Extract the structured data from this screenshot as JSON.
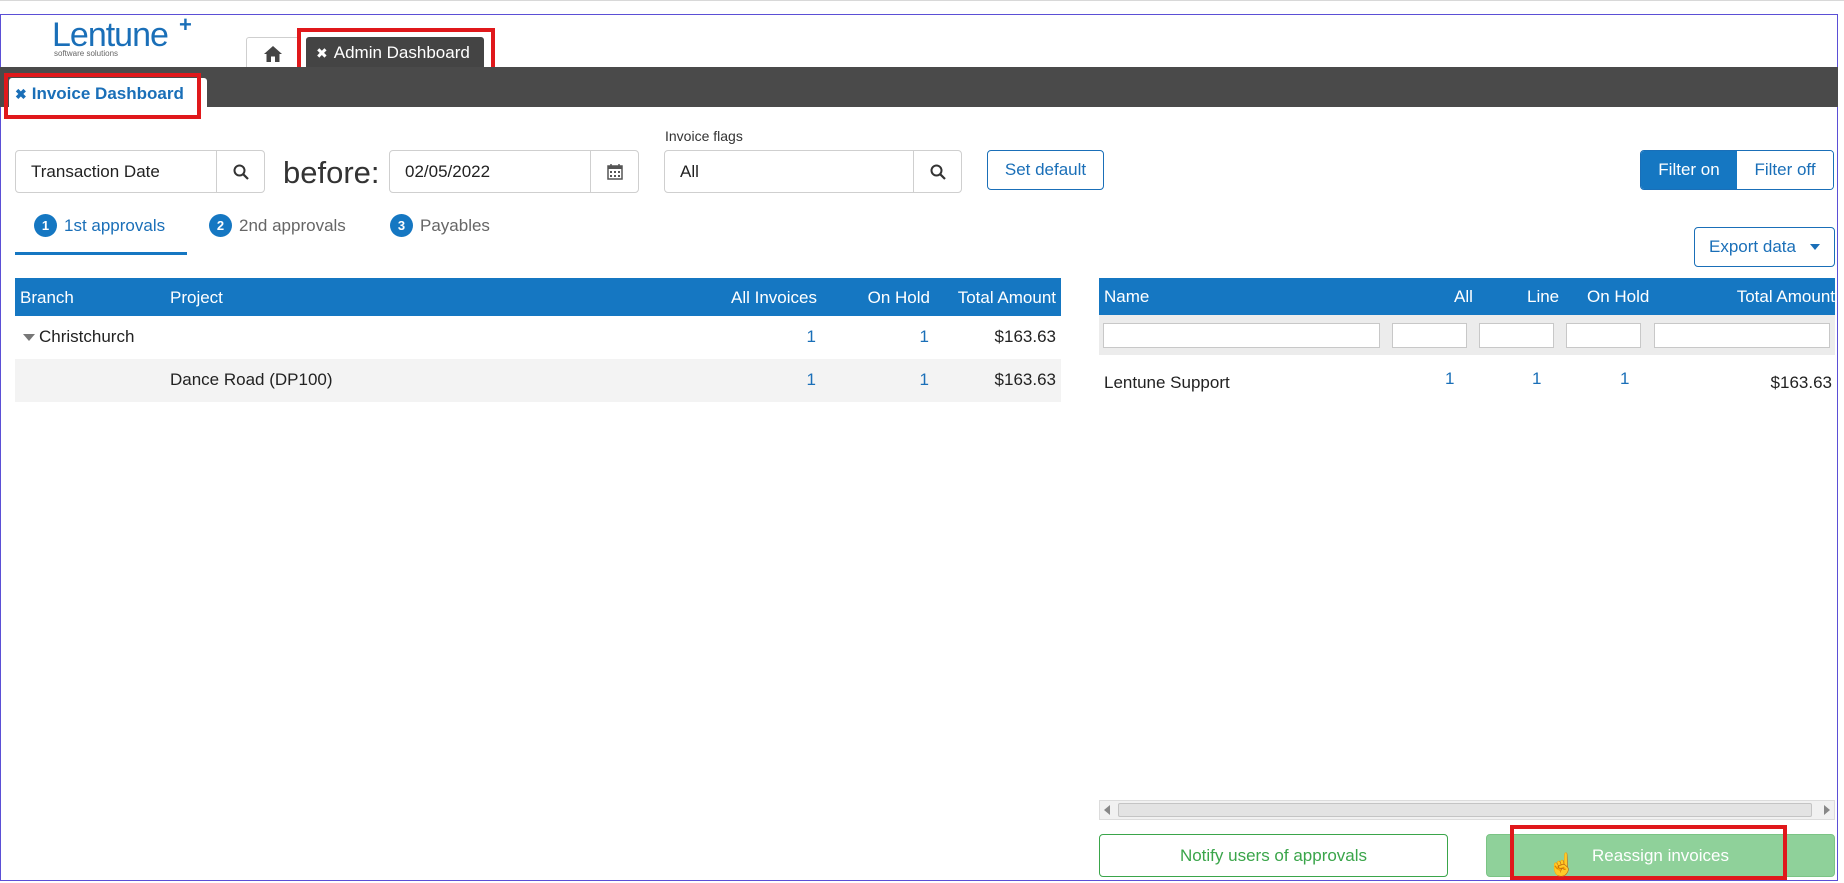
{
  "logo": {
    "word": "Lentune",
    "plus": "+",
    "sub": "software solutions"
  },
  "top_tabs": {
    "home_icon": "home-icon",
    "admin_tab": "Admin Dashboard",
    "close_glyph": "✖"
  },
  "page_tab": {
    "label": "Invoice Dashboard",
    "close_glyph": "✖"
  },
  "filters": {
    "date_field": "Transaction Date",
    "before_label": "before:",
    "date_value": "02/05/2022",
    "flags_label": "Invoice flags",
    "flags_value": "All",
    "set_default": "Set default",
    "filter_on": "Filter on",
    "filter_off": "Filter off"
  },
  "steps": [
    {
      "num": "1",
      "label": "1st approvals",
      "active": true
    },
    {
      "num": "2",
      "label": "2nd approvals",
      "active": false
    },
    {
      "num": "3",
      "label": "Payables",
      "active": false
    }
  ],
  "left_table": {
    "headers": {
      "branch": "Branch",
      "project": "Project",
      "all": "All Invoices",
      "hold": "On Hold",
      "total": "Total Amount"
    },
    "rows": [
      {
        "branch": "Christchurch",
        "project": "",
        "all": "1",
        "hold": "1",
        "total": "$163.63"
      },
      {
        "branch": "",
        "project": "Dance Road (DP100)",
        "all": "1",
        "hold": "1",
        "total": "$163.63"
      }
    ]
  },
  "export_label": "Export data",
  "right_table": {
    "headers": {
      "name": "Name",
      "all": "All",
      "line": "Line",
      "hold": "On Hold",
      "total": "Total Amount"
    },
    "rows": [
      {
        "name": "Lentune Support",
        "all": "1",
        "line": "1",
        "hold": "1",
        "total": "$163.63"
      }
    ]
  },
  "actions": {
    "notify": "Notify users of approvals",
    "reassign": "Reassign invoices"
  },
  "colors": {
    "accent": "#1577c2",
    "green": "#3aa54a",
    "highlight": "#e0181b"
  }
}
